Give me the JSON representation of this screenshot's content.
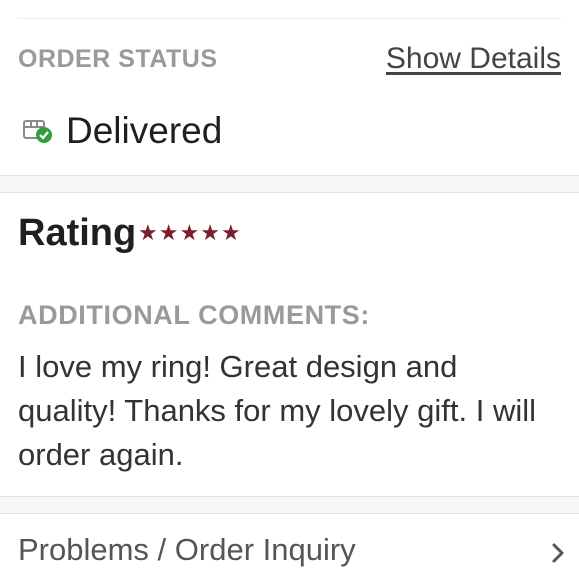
{
  "order_status": {
    "heading": "ORDER STATUS",
    "details_link": "Show Details",
    "status_text": "Delivered",
    "status_icon": "delivered-package-icon",
    "status_color": "#2e9e3f"
  },
  "rating": {
    "label": "Rating",
    "value": 5,
    "max": 5,
    "star_color": "#7a1e2c"
  },
  "comments": {
    "heading": "ADDITIONAL COMMENTS:",
    "text": "I love my ring! Great design and quality! Thanks for my lovely gift. I will order again."
  },
  "inquiry": {
    "label": "Problems / Order Inquiry",
    "icon": "chevron-right-icon"
  }
}
